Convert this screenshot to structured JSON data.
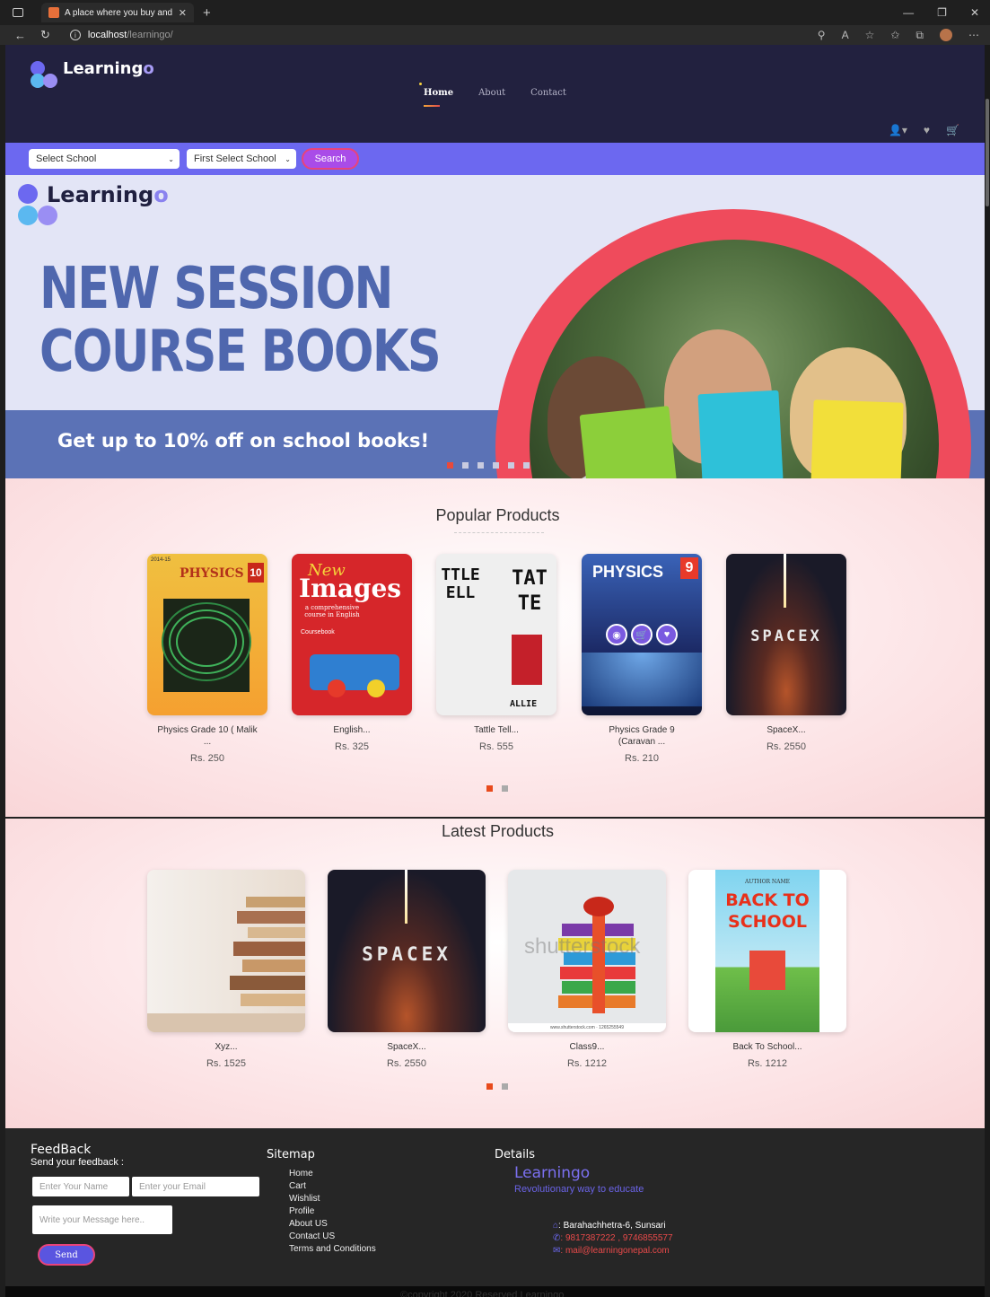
{
  "browser": {
    "tab_title": "A place where you buy and learn",
    "url_host": "localhost",
    "url_path": "/learningo/"
  },
  "brand": {
    "name_main": "Learning",
    "name_o": "o"
  },
  "nav": {
    "items": [
      {
        "label": "Home",
        "active": true
      },
      {
        "label": "About",
        "active": false
      },
      {
        "label": "Contact",
        "active": false
      }
    ]
  },
  "search": {
    "school_select": "Select School",
    "class_select": "First Select School",
    "button": "Search"
  },
  "hero": {
    "headline_line1": "NEW SESSION",
    "headline_line2": "COURSE BOOKS",
    "promo": "Get up to 10% off on school books!",
    "slide_count": 6,
    "active_slide": 1
  },
  "popular": {
    "title": "Popular Products",
    "products": [
      {
        "name": "Physics Grade 10 ( Malik",
        "name2": "...",
        "price": "Rs. 250"
      },
      {
        "name": "English...",
        "name2": "",
        "price": "Rs. 325"
      },
      {
        "name": "Tattle Tell...",
        "name2": "",
        "price": "Rs. 555"
      },
      {
        "name": "Physics Grade 9",
        "name2": "(Caravan ...",
        "price": "Rs. 210"
      },
      {
        "name": "SpaceX...",
        "name2": "",
        "price": "Rs. 2550"
      }
    ],
    "cover_texts": {
      "physics10": "PHYSICS",
      "physics10_num": "10",
      "physics10_year": "2014-15",
      "images_title": "Images",
      "images_new": "New",
      "images_sub": "a comprehensive course in English",
      "images_book": "Coursebook",
      "tattle_left": "TTLE ELL",
      "tattle_right": "TAT TE",
      "tattle_allie": "ALLIE",
      "physics9": "PHYSICS",
      "physics9_num": "9",
      "spacex": "SPACEX"
    }
  },
  "latest": {
    "title": "Latest Products",
    "products": [
      {
        "name": "Xyz...",
        "price": "Rs. 1525"
      },
      {
        "name": "SpaceX...",
        "price": "Rs. 2550"
      },
      {
        "name": "Class9...",
        "price": "Rs. 1212"
      },
      {
        "name": "Back To School...",
        "price": "Rs. 1212"
      }
    ],
    "cover_texts": {
      "spacex": "SPACEX",
      "watermark": "shutterstock",
      "watermark_url": "www.shutterstock.com · 1265255549",
      "author": "AUTHOR NAME",
      "bts_line1": "BACK TO",
      "bts_line2": "SCHOOL"
    }
  },
  "footer": {
    "feedback_title": "FeedBack",
    "feedback_sub": "Send your feedback :",
    "name_placeholder": "Enter Your Name",
    "email_placeholder": "Enter your Email",
    "message_placeholder": "Write your Message here..",
    "send": "Send",
    "sitemap_title": "Sitemap",
    "sitemap": [
      "Home",
      "Cart",
      "Wishlist",
      "Profile",
      "About US",
      "Contact US",
      "Terms and Conditions"
    ],
    "details_title": "Details",
    "details_brand": "Learningo",
    "details_tagline": "Revolutionary way to educate",
    "address": ": Barahachhetra-6, Sunsari",
    "phone": ": 9817387222 , 9746855577",
    "email": ": mail@learningonepal.com",
    "copyright": "©copyright 2020 Reserved Learningo"
  },
  "colors": {
    "nav_bg": "#22213f",
    "search_bg": "#6c68f0",
    "hero_title": "#4f67ae",
    "hero_ring": "#ef4b5c",
    "accent_dot": "#e84a1c"
  }
}
